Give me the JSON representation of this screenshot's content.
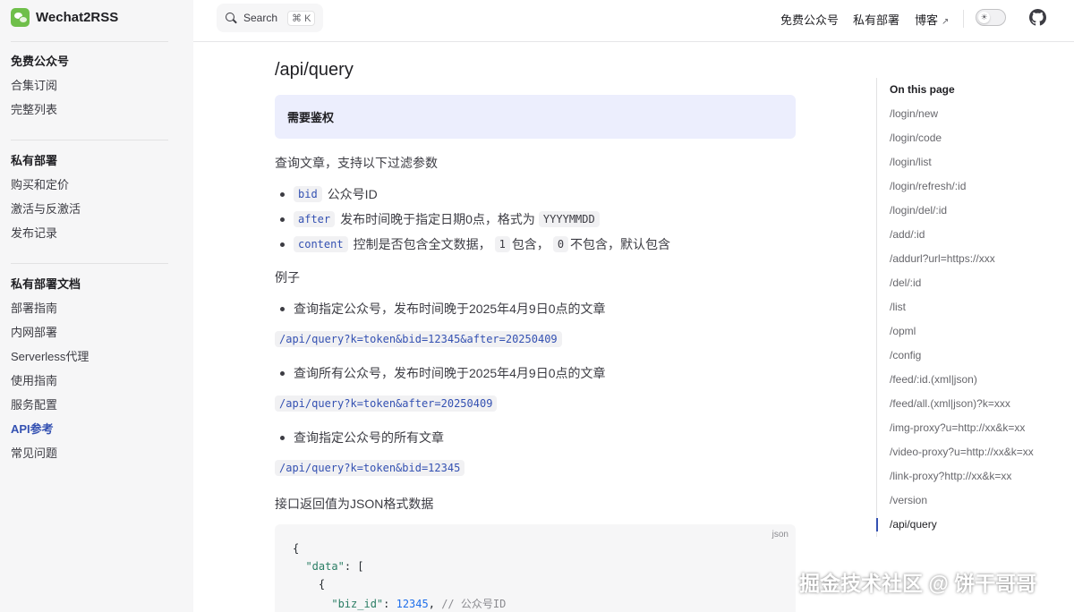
{
  "brand": {
    "name": "Wechat2RSS",
    "logo_icon": "wechat-logo-icon",
    "accent": "#6fbf4a"
  },
  "sidebar": {
    "groups": [
      {
        "title": "免费公众号",
        "items": [
          "合集订阅",
          "完整列表"
        ]
      },
      {
        "title": "私有部署",
        "items": [
          "购买和定价",
          "激活与反激活",
          "发布记录"
        ]
      },
      {
        "title": "私有部署文档",
        "items": [
          "部署指南",
          "内网部署",
          "Serverless代理",
          "使用指南",
          "服务配置",
          "API参考",
          "常见问题"
        ]
      }
    ],
    "active_item": "API参考",
    "active_color": "#3451b2"
  },
  "topbar": {
    "search": {
      "label": "Search",
      "shortcut": "⌘ K"
    },
    "nav": [
      "免费公众号",
      "私有部署",
      "博客"
    ],
    "blog_external_icon": "↗",
    "theme_icon": "sun-icon"
  },
  "main": {
    "title": "/api/query",
    "callout": "需要鉴权",
    "intro": "查询文章，支持以下过滤参数",
    "params": [
      {
        "code": "bid",
        "text": "公众号ID"
      },
      {
        "code": "after",
        "text": "发布时间晚于指定日期0点，格式为",
        "code2": "YYYYMMDD"
      },
      {
        "code": "content",
        "text": "控制是否包含全文数据，",
        "code2": "1",
        "text2": "包含，",
        "code3": "0",
        "text3": "不包含，默认包含"
      }
    ],
    "examples_label": "例子",
    "examples": [
      {
        "text": "查询指定公众号，发布时间晚于2025年4月9日0点的文章",
        "code": "/api/query?k=token&bid=12345&after=20250409"
      },
      {
        "text": "查询所有公众号，发布时间晚于2025年4月9日0点的文章",
        "code": "/api/query?k=token&after=20250409"
      },
      {
        "text": "查询指定公众号的所有文章",
        "code": "/api/query?k=token&bid=12345"
      }
    ],
    "return_text": "接口返回值为JSON格式数据",
    "code_lang": "json",
    "code": {
      "l1": "{",
      "key_data": "\"data\"",
      "l2_rest": ": [",
      "l3": "{",
      "key_biz": "\"biz_id\"",
      "biz_val": "12345",
      "biz_comment": "// 公众号ID"
    }
  },
  "toc": {
    "title": "On this page",
    "items": [
      "/login/new",
      "/login/code",
      "/login/list",
      "/login/refresh/:id",
      "/login/del/:id",
      "/add/:id",
      "/addurl?url=https://xxx",
      "/del/:id",
      "/list",
      "/opml",
      "/config",
      "/feed/:id.(xml|json)",
      "/feed/all.(xml|json)?k=xxx",
      "/img-proxy?u=http://xx&k=xx",
      "/video-proxy?u=http://xx&k=xx",
      "/link-proxy?http://xx&k=xx",
      "/version",
      "/api/query"
    ],
    "active": "/api/query"
  },
  "watermark": "掘金技术社区 @ 饼干哥哥"
}
